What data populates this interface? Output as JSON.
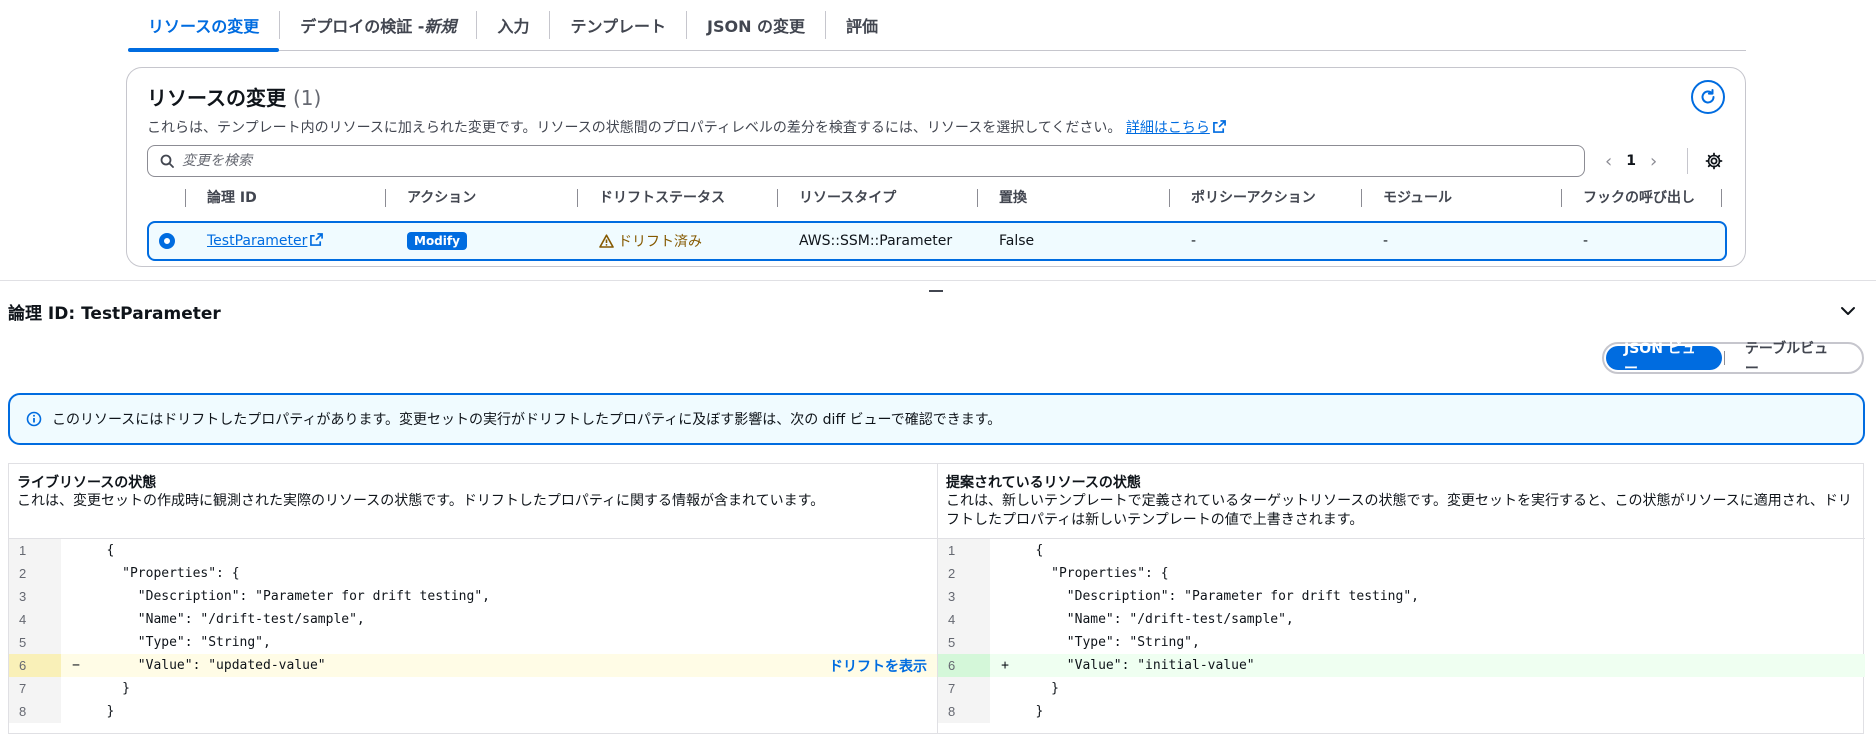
{
  "tabs": [
    {
      "label": "リソースの変更",
      "suffix": ""
    },
    {
      "label": "デプロイの検証 - ",
      "suffix": "新規"
    },
    {
      "label": "入力",
      "suffix": ""
    },
    {
      "label": "テンプレート",
      "suffix": ""
    },
    {
      "label": "JSON の変更",
      "suffix": ""
    },
    {
      "label": "評価",
      "suffix": ""
    }
  ],
  "resource_changes": {
    "title": "リソースの変更",
    "count": "(1)",
    "description": "これらは、テンプレート内のリソースに加えられた変更です。リソースの状態間のプロパティレベルの差分を検査するには、リソースを選択してください。",
    "learn_more": "詳細はこちら",
    "search_placeholder": "変更を検索",
    "page": "1",
    "columns": [
      "論理 ID",
      "アクション",
      "ドリフトステータス",
      "リソースタイプ",
      "置換",
      "ポリシーアクション",
      "モジュール",
      "フックの呼び出し"
    ],
    "row": {
      "logical_id": "TestParameter",
      "action": "Modify",
      "drift_status": "ドリフト済み",
      "resource_type": "AWS::SSM::Parameter",
      "replacement": "False",
      "policy_action": "-",
      "module": "-",
      "hook": "-"
    }
  },
  "detail": {
    "logical_id_label": "論理 ID: TestParameter",
    "view_json": "JSON ビュー",
    "view_table": "テーブルビュー",
    "alert": "このリソースにはドリフトしたプロパティがあります。変更セットの実行がドリフトしたプロパティに及ぼす影響は、次の diff ビューで確認できます。",
    "left": {
      "heading": "ライブリソースの状態",
      "description": "これは、変更セットの作成時に観測された実際のリソースの状態です。ドリフトしたプロパティに関する情報が含まれています。",
      "lines": [
        {
          "n": "1",
          "sign": "",
          "text": "{",
          "kind": ""
        },
        {
          "n": "2",
          "sign": "",
          "text": "  \"Properties\": {",
          "kind": ""
        },
        {
          "n": "3",
          "sign": "",
          "text": "    \"Description\": \"Parameter for drift testing\",",
          "kind": ""
        },
        {
          "n": "4",
          "sign": "",
          "text": "    \"Name\": \"/drift-test/sample\",",
          "kind": ""
        },
        {
          "n": "5",
          "sign": "",
          "text": "    \"Type\": \"String\",",
          "kind": ""
        },
        {
          "n": "6",
          "sign": "−",
          "text": "    \"Value\": \"updated-value\"",
          "kind": "del"
        },
        {
          "n": "7",
          "sign": "",
          "text": "  }",
          "kind": ""
        },
        {
          "n": "8",
          "sign": "",
          "text": "}",
          "kind": ""
        }
      ],
      "show_drift": "ドリフトを表示"
    },
    "right": {
      "heading": "提案されているリソースの状態",
      "description": "これは、新しいテンプレートで定義されているターゲットリソースの状態です。変更セットを実行すると、この状態がリソースに適用され、ドリフトしたプロパティは新しいテンプレートの値で上書きされます。",
      "lines": [
        {
          "n": "1",
          "sign": "",
          "text": "{",
          "kind": ""
        },
        {
          "n": "2",
          "sign": "",
          "text": "  \"Properties\": {",
          "kind": ""
        },
        {
          "n": "3",
          "sign": "",
          "text": "    \"Description\": \"Parameter for drift testing\",",
          "kind": ""
        },
        {
          "n": "4",
          "sign": "",
          "text": "    \"Name\": \"/drift-test/sample\",",
          "kind": ""
        },
        {
          "n": "5",
          "sign": "",
          "text": "    \"Type\": \"String\",",
          "kind": ""
        },
        {
          "n": "6",
          "sign": "+",
          "text": "    \"Value\": \"initial-value\"",
          "kind": "add"
        },
        {
          "n": "7",
          "sign": "",
          "text": "  }",
          "kind": ""
        },
        {
          "n": "8",
          "sign": "",
          "text": "}",
          "kind": ""
        }
      ]
    }
  },
  "colors": {
    "accent": "#006ce0",
    "warning": "#855900",
    "deleted_bg": "#fffce6",
    "added_bg": "#effff1"
  },
  "icons": [
    "external-link-icon",
    "refresh-icon",
    "search-icon",
    "chevron-left-icon",
    "chevron-right-icon",
    "settings-icon",
    "warning-icon",
    "chevron-down-icon",
    "info-icon"
  ]
}
